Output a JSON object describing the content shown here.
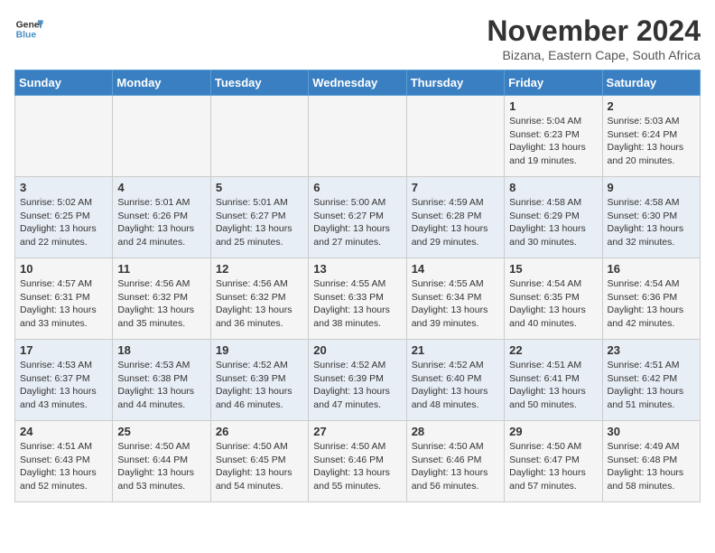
{
  "header": {
    "logo_line1": "General",
    "logo_line2": "Blue",
    "month": "November 2024",
    "location": "Bizana, Eastern Cape, South Africa"
  },
  "days_of_week": [
    "Sunday",
    "Monday",
    "Tuesday",
    "Wednesday",
    "Thursday",
    "Friday",
    "Saturday"
  ],
  "weeks": [
    [
      {
        "day": "",
        "info": ""
      },
      {
        "day": "",
        "info": ""
      },
      {
        "day": "",
        "info": ""
      },
      {
        "day": "",
        "info": ""
      },
      {
        "day": "",
        "info": ""
      },
      {
        "day": "1",
        "info": "Sunrise: 5:04 AM\nSunset: 6:23 PM\nDaylight: 13 hours and 19 minutes."
      },
      {
        "day": "2",
        "info": "Sunrise: 5:03 AM\nSunset: 6:24 PM\nDaylight: 13 hours and 20 minutes."
      }
    ],
    [
      {
        "day": "3",
        "info": "Sunrise: 5:02 AM\nSunset: 6:25 PM\nDaylight: 13 hours and 22 minutes."
      },
      {
        "day": "4",
        "info": "Sunrise: 5:01 AM\nSunset: 6:26 PM\nDaylight: 13 hours and 24 minutes."
      },
      {
        "day": "5",
        "info": "Sunrise: 5:01 AM\nSunset: 6:27 PM\nDaylight: 13 hours and 25 minutes."
      },
      {
        "day": "6",
        "info": "Sunrise: 5:00 AM\nSunset: 6:27 PM\nDaylight: 13 hours and 27 minutes."
      },
      {
        "day": "7",
        "info": "Sunrise: 4:59 AM\nSunset: 6:28 PM\nDaylight: 13 hours and 29 minutes."
      },
      {
        "day": "8",
        "info": "Sunrise: 4:58 AM\nSunset: 6:29 PM\nDaylight: 13 hours and 30 minutes."
      },
      {
        "day": "9",
        "info": "Sunrise: 4:58 AM\nSunset: 6:30 PM\nDaylight: 13 hours and 32 minutes."
      }
    ],
    [
      {
        "day": "10",
        "info": "Sunrise: 4:57 AM\nSunset: 6:31 PM\nDaylight: 13 hours and 33 minutes."
      },
      {
        "day": "11",
        "info": "Sunrise: 4:56 AM\nSunset: 6:32 PM\nDaylight: 13 hours and 35 minutes."
      },
      {
        "day": "12",
        "info": "Sunrise: 4:56 AM\nSunset: 6:32 PM\nDaylight: 13 hours and 36 minutes."
      },
      {
        "day": "13",
        "info": "Sunrise: 4:55 AM\nSunset: 6:33 PM\nDaylight: 13 hours and 38 minutes."
      },
      {
        "day": "14",
        "info": "Sunrise: 4:55 AM\nSunset: 6:34 PM\nDaylight: 13 hours and 39 minutes."
      },
      {
        "day": "15",
        "info": "Sunrise: 4:54 AM\nSunset: 6:35 PM\nDaylight: 13 hours and 40 minutes."
      },
      {
        "day": "16",
        "info": "Sunrise: 4:54 AM\nSunset: 6:36 PM\nDaylight: 13 hours and 42 minutes."
      }
    ],
    [
      {
        "day": "17",
        "info": "Sunrise: 4:53 AM\nSunset: 6:37 PM\nDaylight: 13 hours and 43 minutes."
      },
      {
        "day": "18",
        "info": "Sunrise: 4:53 AM\nSunset: 6:38 PM\nDaylight: 13 hours and 44 minutes."
      },
      {
        "day": "19",
        "info": "Sunrise: 4:52 AM\nSunset: 6:39 PM\nDaylight: 13 hours and 46 minutes."
      },
      {
        "day": "20",
        "info": "Sunrise: 4:52 AM\nSunset: 6:39 PM\nDaylight: 13 hours and 47 minutes."
      },
      {
        "day": "21",
        "info": "Sunrise: 4:52 AM\nSunset: 6:40 PM\nDaylight: 13 hours and 48 minutes."
      },
      {
        "day": "22",
        "info": "Sunrise: 4:51 AM\nSunset: 6:41 PM\nDaylight: 13 hours and 50 minutes."
      },
      {
        "day": "23",
        "info": "Sunrise: 4:51 AM\nSunset: 6:42 PM\nDaylight: 13 hours and 51 minutes."
      }
    ],
    [
      {
        "day": "24",
        "info": "Sunrise: 4:51 AM\nSunset: 6:43 PM\nDaylight: 13 hours and 52 minutes."
      },
      {
        "day": "25",
        "info": "Sunrise: 4:50 AM\nSunset: 6:44 PM\nDaylight: 13 hours and 53 minutes."
      },
      {
        "day": "26",
        "info": "Sunrise: 4:50 AM\nSunset: 6:45 PM\nDaylight: 13 hours and 54 minutes."
      },
      {
        "day": "27",
        "info": "Sunrise: 4:50 AM\nSunset: 6:46 PM\nDaylight: 13 hours and 55 minutes."
      },
      {
        "day": "28",
        "info": "Sunrise: 4:50 AM\nSunset: 6:46 PM\nDaylight: 13 hours and 56 minutes."
      },
      {
        "day": "29",
        "info": "Sunrise: 4:50 AM\nSunset: 6:47 PM\nDaylight: 13 hours and 57 minutes."
      },
      {
        "day": "30",
        "info": "Sunrise: 4:49 AM\nSunset: 6:48 PM\nDaylight: 13 hours and 58 minutes."
      }
    ]
  ]
}
